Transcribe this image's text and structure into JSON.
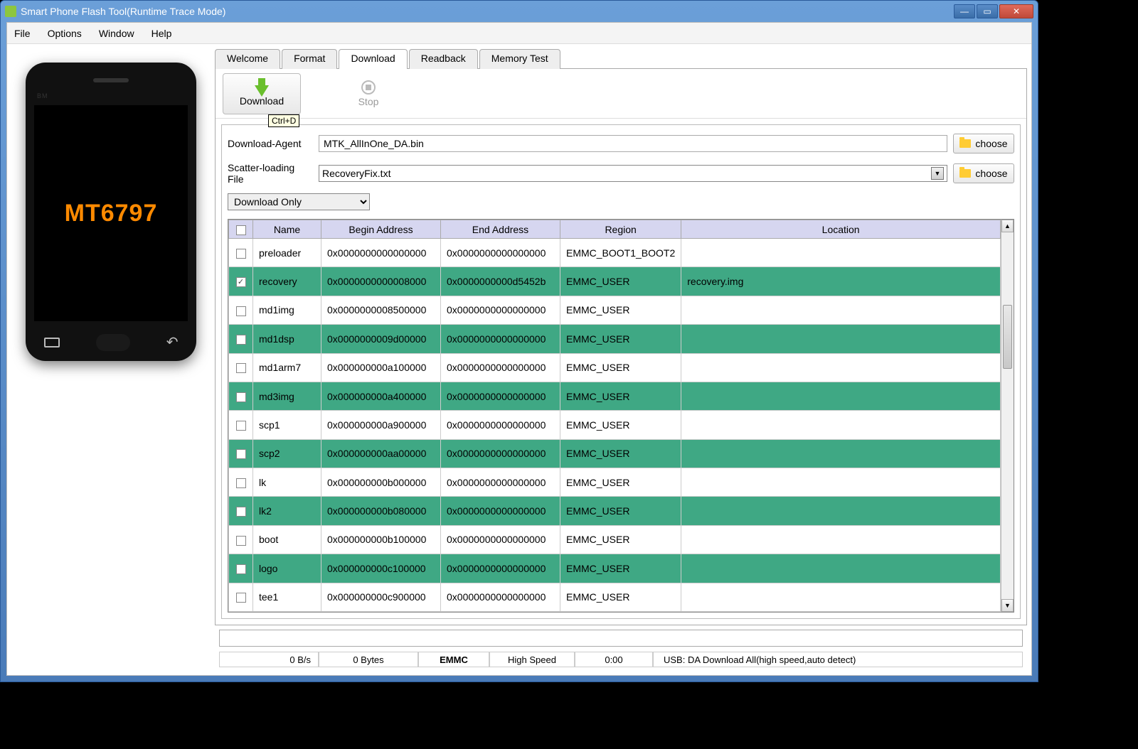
{
  "window": {
    "title": "Smart Phone Flash Tool(Runtime Trace Mode)"
  },
  "menu": {
    "file": "File",
    "options": "Options",
    "window": "Window",
    "help": "Help"
  },
  "phone": {
    "chip": "MT6797",
    "bm": "BM"
  },
  "tabs": {
    "welcome": "Welcome",
    "format": "Format",
    "download": "Download",
    "readback": "Readback",
    "memory": "Memory Test"
  },
  "toolbar": {
    "download": "Download",
    "stop": "Stop",
    "tooltip": "Ctrl+D"
  },
  "form": {
    "da_label": "Download-Agent",
    "da_value": "MTK_AllInOne_DA.bin",
    "scatter_label": "Scatter-loading File",
    "scatter_value": "RecoveryFix.txt",
    "choose": "choose",
    "mode": "Download Only"
  },
  "table": {
    "headers": {
      "name": "Name",
      "begin": "Begin Address",
      "end": "End Address",
      "region": "Region",
      "location": "Location"
    },
    "rows": [
      {
        "chk": false,
        "green": false,
        "name": "preloader",
        "begin": "0x0000000000000000",
        "end": "0x0000000000000000",
        "region": "EMMC_BOOT1_BOOT2",
        "location": ""
      },
      {
        "chk": true,
        "green": true,
        "name": "recovery",
        "begin": "0x0000000000008000",
        "end": "0x0000000000d5452b",
        "region": "EMMC_USER",
        "location": "recovery.img"
      },
      {
        "chk": false,
        "green": false,
        "name": "md1img",
        "begin": "0x0000000008500000",
        "end": "0x0000000000000000",
        "region": "EMMC_USER",
        "location": ""
      },
      {
        "chk": false,
        "green": true,
        "name": "md1dsp",
        "begin": "0x0000000009d00000",
        "end": "0x0000000000000000",
        "region": "EMMC_USER",
        "location": ""
      },
      {
        "chk": false,
        "green": false,
        "name": "md1arm7",
        "begin": "0x000000000a100000",
        "end": "0x0000000000000000",
        "region": "EMMC_USER",
        "location": ""
      },
      {
        "chk": false,
        "green": true,
        "name": "md3img",
        "begin": "0x000000000a400000",
        "end": "0x0000000000000000",
        "region": "EMMC_USER",
        "location": ""
      },
      {
        "chk": false,
        "green": false,
        "name": "scp1",
        "begin": "0x000000000a900000",
        "end": "0x0000000000000000",
        "region": "EMMC_USER",
        "location": ""
      },
      {
        "chk": false,
        "green": true,
        "name": "scp2",
        "begin": "0x000000000aa00000",
        "end": "0x0000000000000000",
        "region": "EMMC_USER",
        "location": ""
      },
      {
        "chk": false,
        "green": false,
        "name": "lk",
        "begin": "0x000000000b000000",
        "end": "0x0000000000000000",
        "region": "EMMC_USER",
        "location": ""
      },
      {
        "chk": false,
        "green": true,
        "name": "lk2",
        "begin": "0x000000000b080000",
        "end": "0x0000000000000000",
        "region": "EMMC_USER",
        "location": ""
      },
      {
        "chk": false,
        "green": false,
        "name": "boot",
        "begin": "0x000000000b100000",
        "end": "0x0000000000000000",
        "region": "EMMC_USER",
        "location": ""
      },
      {
        "chk": false,
        "green": true,
        "name": "logo",
        "begin": "0x000000000c100000",
        "end": "0x0000000000000000",
        "region": "EMMC_USER",
        "location": ""
      },
      {
        "chk": false,
        "green": false,
        "name": "tee1",
        "begin": "0x000000000c900000",
        "end": "0x0000000000000000",
        "region": "EMMC_USER",
        "location": ""
      }
    ]
  },
  "status": {
    "speed": "0 B/s",
    "bytes": "0 Bytes",
    "storage": "EMMC",
    "mode": "High Speed",
    "time": "0:00",
    "usb": "USB: DA Download All(high speed,auto detect)"
  }
}
